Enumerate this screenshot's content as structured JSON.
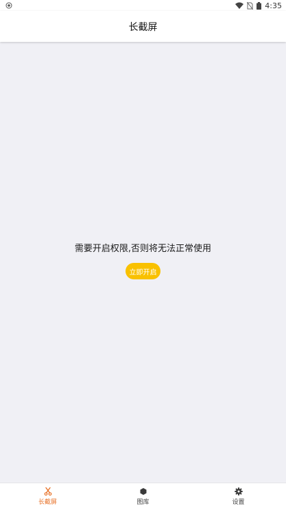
{
  "status_bar": {
    "time": "4:35",
    "icons": [
      "android-icon",
      "wifi-icon",
      "no-sim-icon",
      "battery-icon"
    ]
  },
  "app_bar": {
    "title": "长截屏"
  },
  "permission": {
    "message": "需要开启权限,否则将无法正常使用",
    "button_label": "立即开启"
  },
  "bottom_nav": {
    "items": [
      {
        "label": "长截屏",
        "icon": "scissors-icon",
        "active": true
      },
      {
        "label": "图库",
        "icon": "hexagon-icon",
        "active": false
      },
      {
        "label": "设置",
        "icon": "gear-icon",
        "active": false
      }
    ]
  },
  "colors": {
    "accent": "#e8732a",
    "button": "#f9c100",
    "background": "#f0f0f5"
  }
}
